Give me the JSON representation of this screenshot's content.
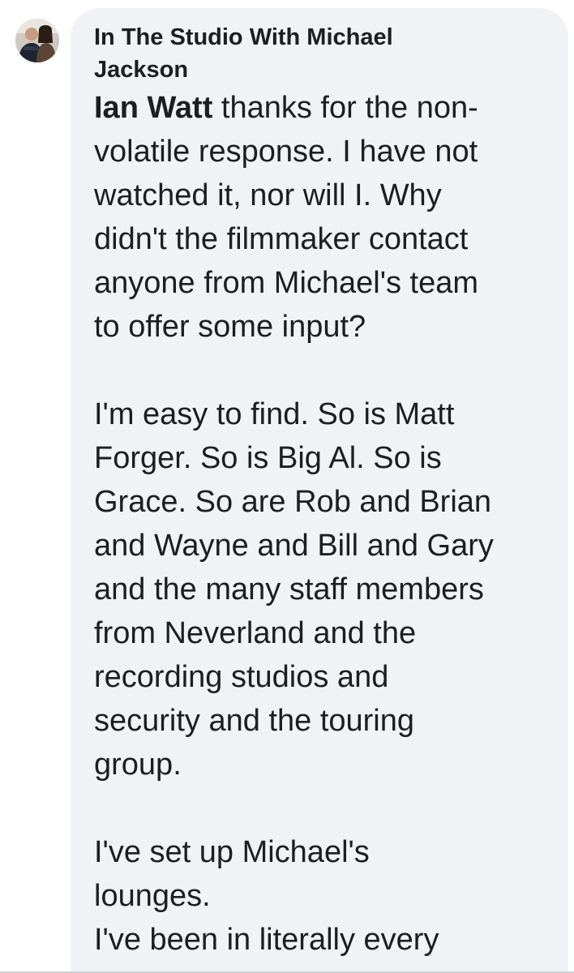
{
  "comment": {
    "author": "In The Studio With Michael Jackson",
    "mention": "Ian Watt",
    "paragraphs": [
      {
        "first_line_rest": " thanks for the non-",
        "lines": [
          "volatile response. I have not",
          "watched it, nor will I. Why",
          "didn't the filmmaker contact",
          "anyone from Michael's team",
          "to offer some input?"
        ]
      },
      {
        "lines": [
          "I'm easy to find. So is Matt",
          "Forger. So is Big Al. So is",
          "Grace. So are Rob and Brian",
          "and Wayne and Bill and Gary",
          "and the many staff members",
          "from Neverland and the",
          "recording studios and",
          "security and the touring",
          "group."
        ]
      },
      {
        "lines": [
          "I've set up Michael's",
          "lounges.",
          "I've been in literally every"
        ]
      }
    ]
  },
  "colors": {
    "bubble_bg": "#f0f2f5",
    "text": "#1c1e21"
  }
}
